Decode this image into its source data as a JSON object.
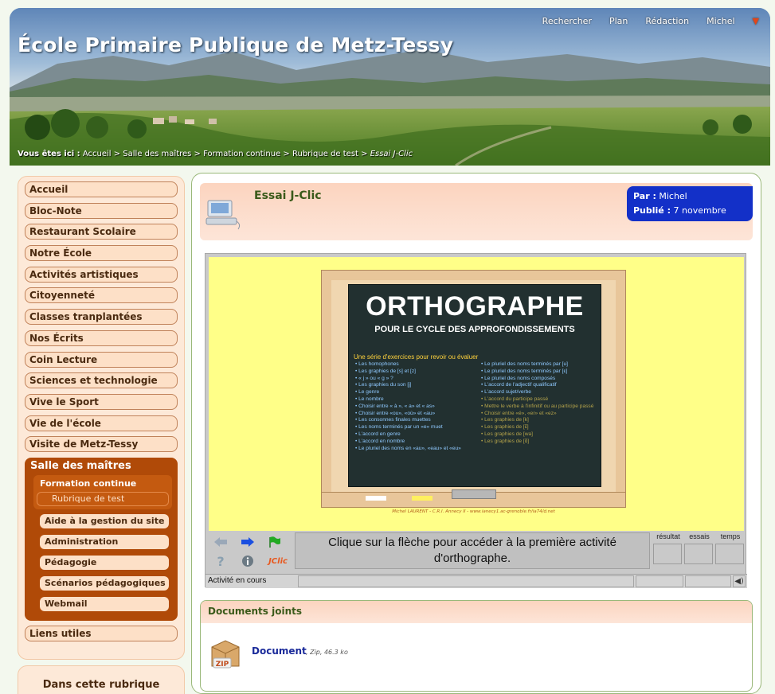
{
  "header": {
    "site_title": "École Primaire Publique de Metz-Tessy",
    "top_nav": [
      "Rechercher",
      "Plan",
      "Rédaction",
      "Michel"
    ],
    "breadcrumb_label": "Vous êtes ici :",
    "breadcrumb_path": " Accueil > Salle des maîtres > Formation continue > Rubrique de test > ",
    "breadcrumb_current": "Essai J-Clic"
  },
  "sidebar": {
    "items_top": [
      "Accueil",
      "Bloc-Note",
      "Restaurant Scolaire",
      "Notre École",
      "Activités artistiques",
      "Citoyenneté",
      "Classes tranplantées",
      "Nos Écrits",
      "Coin Lecture",
      "Sciences et technologie",
      "Vive le Sport",
      "Vie de l'école",
      "Visite de Metz-Tessy"
    ],
    "active_section": "Salle des maîtres",
    "active_sub": "Formation continue",
    "active_subsub": "Rubrique de test",
    "admin_items": [
      "Aide à la gestion du site",
      "Administration",
      "Pédagogie",
      "Scénarios pédagogiques",
      "Webmail"
    ],
    "links": "Liens utiles",
    "rubrique_box_title": "Dans cette rubrique"
  },
  "article": {
    "title": "Essai J-Clic",
    "author_label": "Par :",
    "author": "Michel",
    "published_label": "Publié :",
    "published": "7 novembre"
  },
  "applet": {
    "board_title": "ORTHOGRAPHE",
    "board_subtitle": "POUR LE CYCLE DES APPROFONDISSEMENTS",
    "board_intro": "Une série d'exercices pour revoir ou évaluer",
    "left_column": [
      "• Les homophones",
      "• Les graphies de [s] et [z]",
      "• « j » ou « g » ?",
      "• Les graphies du son [j]",
      "• Le genre",
      "• Le nombre",
      "• Choisir entre « à », « a» et « as»",
      "• Choisir entre «ou», «où» et «au»",
      "• Les consonnes finales muettes",
      "• Les noms terminés par un «e» muet",
      "• L'accord en genre",
      "• L'accord en nombre",
      "• Le pluriel des noms en «au», «eau» et «eu»"
    ],
    "right_column": [
      "• Le pluriel des noms terminés par [u]",
      "• Le pluriel des noms terminés par [ɛ]",
      "• Le pluriel des noms composés",
      "• L'accord de l'adjectif qualificatif",
      "• L'accord sujet/verbe"
    ],
    "right_column_dim": [
      "• L'accord du participe passé",
      "• Mettre le verbe à l'infinitif ou au participe passé",
      "• Choisir entre «é», «er» et «ez»",
      "• Les graphies de [k]",
      "• Les graphies de [ɛ̃]",
      "• Les graphies de [wa]",
      "• Les graphies de [ɑ̃]"
    ],
    "credit": "Michel LAURENT - C.R.I. Annecy II - www.ianecy1.ac-grenoble.fr/ia74/d.net",
    "message": "Clique sur la flèche pour accéder à la première activité d'orthographe.",
    "counter_labels": [
      "résultat",
      "essais",
      "temps"
    ],
    "status": "Activité en cours",
    "jclic_label": "JClic"
  },
  "documents": {
    "header": "Documents joints",
    "file_name": "Document",
    "file_meta": ", Zip, 46.3 ko"
  },
  "colors": {
    "accent_orange": "#b04a08",
    "meta_blue": "#1330c8",
    "title_green": "#3a5a1a"
  },
  "icons": [
    "computer-icon",
    "prev-arrow-icon",
    "next-arrow-icon",
    "flag-icon",
    "help-icon",
    "info-icon",
    "speaker-icon",
    "zip-icon",
    "dropdown-arrow-icon"
  ]
}
